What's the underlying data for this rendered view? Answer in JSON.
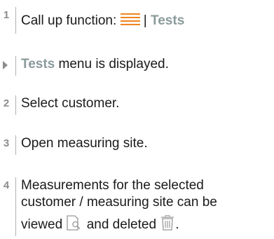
{
  "steps": [
    {
      "marker": "1",
      "text_before": "Call up function: ",
      "menu_icon": "hamburger-menu-icon",
      "separator": " | ",
      "menu_name": "Tests"
    },
    {
      "marker_icon": "result-triangle-icon",
      "highlight": "Tests",
      "text_after": " menu is displayed."
    },
    {
      "marker": "2",
      "text": "Select customer."
    },
    {
      "marker": "3",
      "text": "Open measuring site."
    },
    {
      "marker": "4",
      "line1": "Measurements for the selected",
      "line2": "customer / measuring site can be",
      "line3_before": "viewed ",
      "view_icon": "view-document-icon",
      "line3_middle": " and deleted ",
      "delete_icon": "trash-icon",
      "line3_after": "."
    }
  ],
  "colors": {
    "accent": "#8a9a9a",
    "menu_icon": "#f0851e",
    "marker": "#8c8c8c"
  }
}
